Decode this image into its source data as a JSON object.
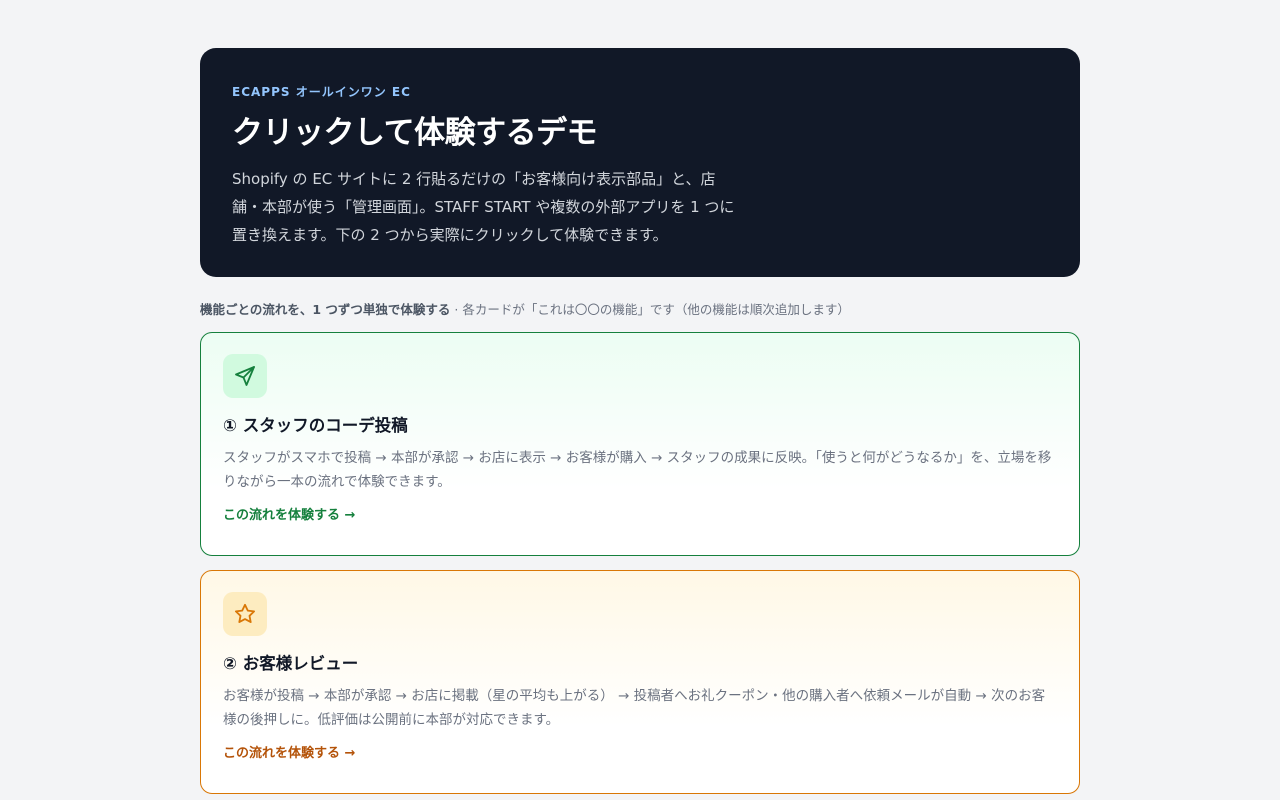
{
  "hero": {
    "eyebrow": "ECAPPS オールインワン EC",
    "title": "クリックして体験するデモ",
    "description": "Shopify の EC サイトに 2 行貼るだけの「お客様向け表示部品」と、店舗・本部が使う「管理画面」。STAFF START や複数の外部アプリを 1 つに置き換えます。下の 2 つから実際にクリックして体験できます。"
  },
  "section": {
    "note_strong": "機能ごとの流れを、1 つずつ単独で体験する",
    "note_rest": " · 各カードが「これは〇〇の機能」です（他の機能は順次追加します）"
  },
  "cards": [
    {
      "icon": "send-icon",
      "accent": "#15803d",
      "title": "① スタッフのコーデ投稿",
      "description": "スタッフがスマホで投稿 → 本部が承認 → お店に表示 → お客様が購入 → スタッフの成果に反映。「使うと何がどうなるか」を、立場を移りながら一本の流れで体験できます。",
      "link": "この流れを体験する →"
    },
    {
      "icon": "star-icon",
      "accent": "#d97706",
      "title": "② お客様レビュー",
      "description": "お客様が投稿 → 本部が承認 → お店に掲載（星の平均も上がる） → 投稿者へお礼クーポン・他の購入者へ依頼メールが自動 → 次のお客様の後押しに。低評価は公開前に本部が対応できます。",
      "link": "この流れを体験する →"
    }
  ]
}
